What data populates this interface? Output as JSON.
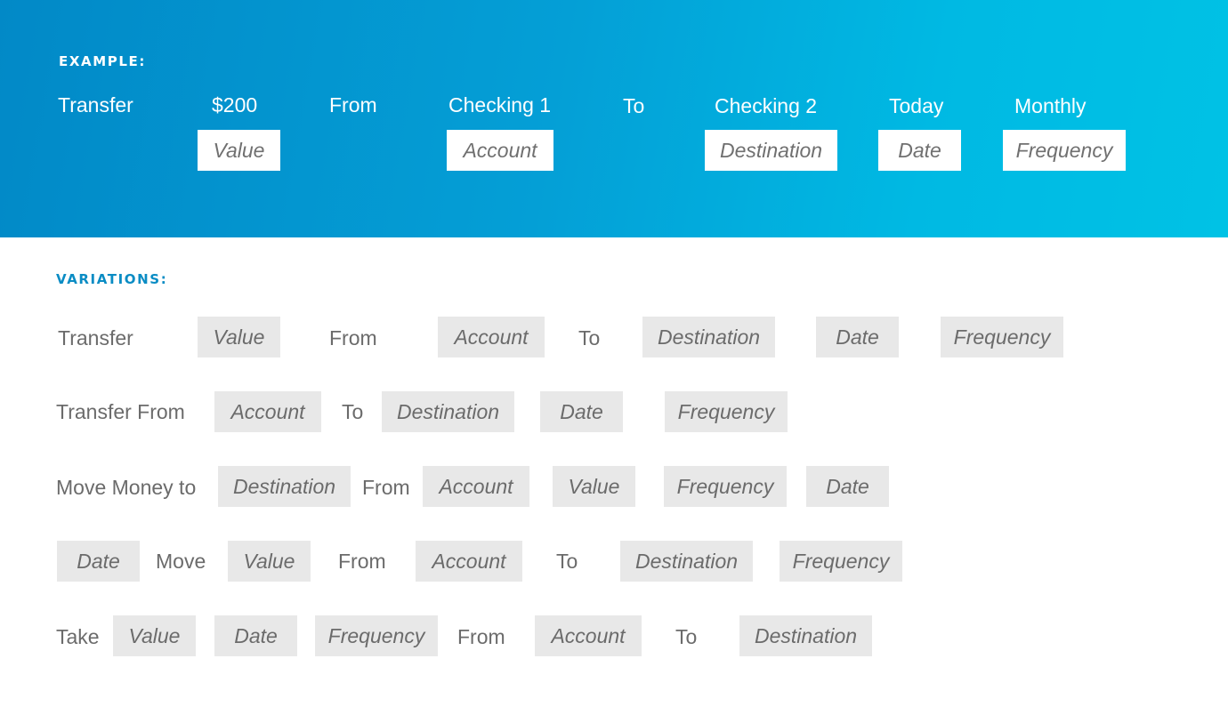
{
  "example": {
    "heading": "EXAMPLE:",
    "words": [
      "Transfer",
      "$200",
      "From",
      "Checking 1",
      "To",
      "Checking 2",
      "Today",
      "Monthly"
    ],
    "boxes": [
      "Value",
      "Account",
      "Destination",
      "Date",
      "Frequency"
    ]
  },
  "variations": {
    "heading": "VARIATIONS:",
    "rows": [
      {
        "words": [
          "Transfer",
          "From",
          "To"
        ],
        "boxes": [
          "Value",
          "Account",
          "Destination",
          "Date",
          "Frequency"
        ]
      },
      {
        "words": [
          "Transfer From",
          "To"
        ],
        "boxes": [
          "Account",
          "Destination",
          "Date",
          "Frequency"
        ]
      },
      {
        "words": [
          "Move Money to",
          "From"
        ],
        "boxes": [
          "Destination",
          "Account",
          "Value",
          "Frequency",
          "Date"
        ]
      },
      {
        "words": [
          "Move",
          "From",
          "To"
        ],
        "boxes": [
          "Date",
          "Value",
          "Account",
          "Destination",
          "Frequency"
        ]
      },
      {
        "words": [
          "Take",
          "From",
          "To"
        ],
        "boxes": [
          "Value",
          "Date",
          "Frequency",
          "Account",
          "Destination"
        ]
      }
    ]
  },
  "colors": {
    "hero_start": "#0289c7",
    "hero_end": "#00c2e5",
    "heading_accent": "#0a8cc4",
    "chip_gray": "#e8e8e8",
    "text_gray": "#6b6b6b"
  }
}
